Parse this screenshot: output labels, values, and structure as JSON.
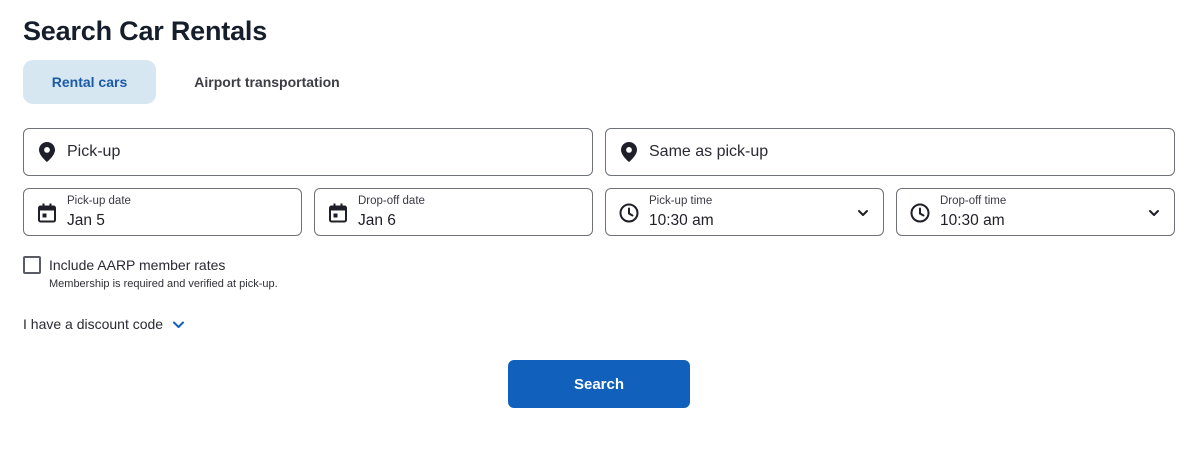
{
  "page": {
    "title": "Search Car Rentals"
  },
  "tabs": [
    {
      "label": "Rental cars",
      "active": true
    },
    {
      "label": "Airport transportation",
      "active": false
    }
  ],
  "location": {
    "pickup_placeholder": "Pick-up",
    "dropoff_placeholder": "Same as pick-up",
    "icon": "map-pin-icon"
  },
  "dates": {
    "pickup_date_label": "Pick-up date",
    "pickup_date_value": "Jan 5",
    "dropoff_date_label": "Drop-off date",
    "dropoff_date_value": "Jan 6",
    "pickup_time_label": "Pick-up time",
    "pickup_time_value": "10:30 am",
    "dropoff_time_label": "Drop-off time",
    "dropoff_time_value": "10:30 am"
  },
  "aarp": {
    "label": "Include AARP member rates",
    "note": "Membership is required and verified at pick-up.",
    "checked": false
  },
  "discount": {
    "label": "I have a discount code"
  },
  "search": {
    "label": "Search"
  },
  "colors": {
    "accent": "#1160bb",
    "active_tab_bg": "#d7e7f2",
    "active_tab_text": "#1b5aa6",
    "border": "#6f7178"
  }
}
